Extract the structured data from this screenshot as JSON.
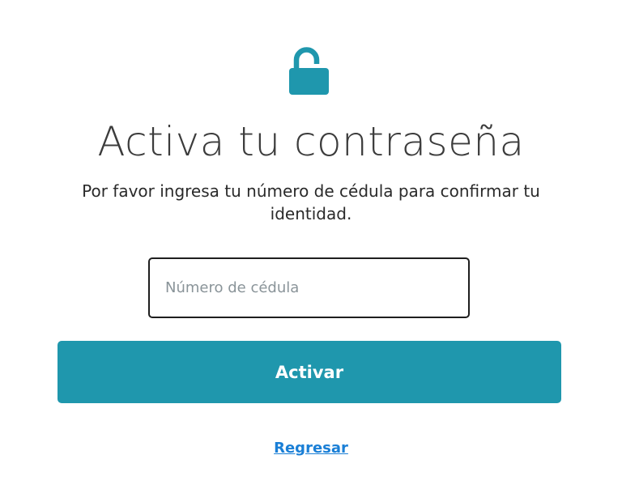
{
  "icons": {
    "lock": "unlocked-padlock-icon"
  },
  "colors": {
    "accent": "#1f97ad",
    "title": "#3c3c3c",
    "link": "#1a7fd6",
    "input_border": "#1e1e1e"
  },
  "page": {
    "title": "Activa tu contraseña",
    "subtitle": "Por favor ingresa tu número de cédula para confirmar tu identidad."
  },
  "form": {
    "id_placeholder": "Número de cédula",
    "id_value": "",
    "submit_label": "Activar"
  },
  "back": {
    "label": "Regresar"
  }
}
